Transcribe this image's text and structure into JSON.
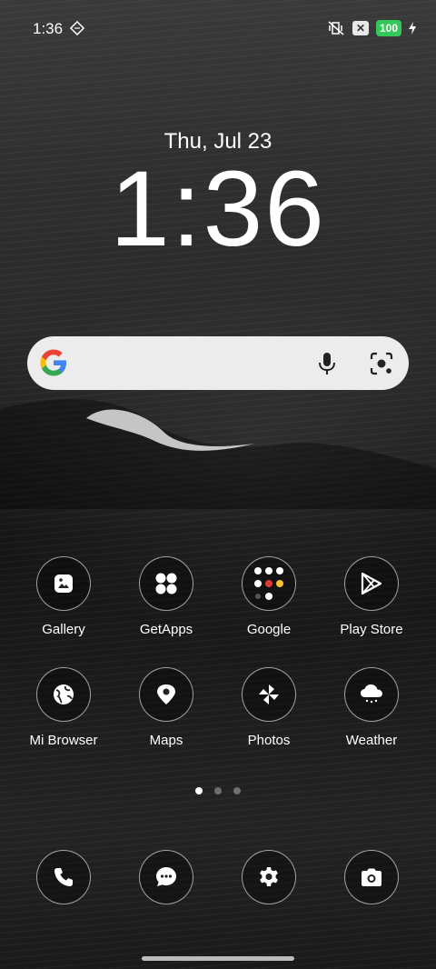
{
  "status_bar": {
    "time": "1:36",
    "battery": "100"
  },
  "lock": {
    "date": "Thu, Jul 23",
    "time": "1:36"
  },
  "search": {
    "logo": "google-g-icon",
    "mic": "mic-icon",
    "lens": "lens-camera-icon"
  },
  "apps": [
    {
      "label": "Gallery",
      "icon": "gallery-icon"
    },
    {
      "label": "GetApps",
      "icon": "getapps-icon"
    },
    {
      "label": "Google",
      "icon": "google-folder-icon"
    },
    {
      "label": "Play Store",
      "icon": "play-store-icon"
    },
    {
      "label": "Mi Browser",
      "icon": "globe-icon"
    },
    {
      "label": "Maps",
      "icon": "map-pin-icon"
    },
    {
      "label": "Photos",
      "icon": "pinwheel-icon"
    },
    {
      "label": "Weather",
      "icon": "weather-cloud-icon"
    }
  ],
  "page_indicator": {
    "count": 3,
    "active": 1
  },
  "dock": [
    {
      "icon": "phone-icon"
    },
    {
      "icon": "messages-icon"
    },
    {
      "icon": "settings-icon"
    },
    {
      "icon": "camera-icon"
    }
  ],
  "colors": {
    "battery": "#34c759"
  }
}
